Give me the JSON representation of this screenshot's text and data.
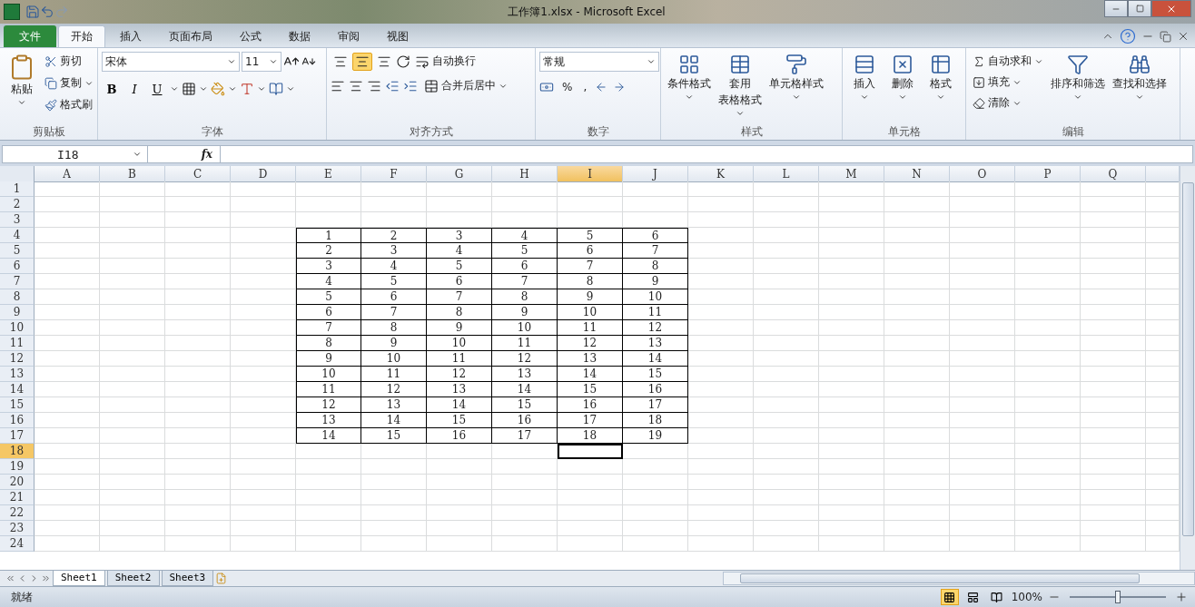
{
  "window": {
    "title": "工作簿1.xlsx  -  Microsoft Excel"
  },
  "ribbon_tabs": [
    {
      "label": "文件",
      "kind": "file",
      "selected": false
    },
    {
      "label": "开始",
      "kind": "tab",
      "selected": true
    },
    {
      "label": "插入",
      "kind": "tab",
      "selected": false
    },
    {
      "label": "页面布局",
      "kind": "tab",
      "selected": false
    },
    {
      "label": "公式",
      "kind": "tab",
      "selected": false
    },
    {
      "label": "数据",
      "kind": "tab",
      "selected": false
    },
    {
      "label": "审阅",
      "kind": "tab",
      "selected": false
    },
    {
      "label": "视图",
      "kind": "tab",
      "selected": false
    }
  ],
  "groups": [
    {
      "kind": "clipboard",
      "label": "剪贴板",
      "paste": "粘贴",
      "items": [
        "剪切",
        "复制",
        "格式刷"
      ]
    },
    {
      "kind": "font",
      "label": "字体",
      "font": "宋体",
      "size": "11",
      "bold": "B",
      "italic": "I",
      "underline": "U"
    },
    {
      "kind": "alignment",
      "label": "对齐方式",
      "vertical": [
        {
          "selected": false
        },
        {
          "selected": true
        },
        {
          "selected": false
        }
      ],
      "wrap": "自动换行",
      "merge": "合并后居中"
    },
    {
      "kind": "number",
      "label": "数字",
      "format": "常规",
      "percent": "%",
      "comma": ","
    },
    {
      "kind": "styles",
      "label": "样式",
      "buttons": [
        {
          "lines": [
            "条件格式"
          ]
        },
        {
          "lines": [
            "套用",
            "表格格式"
          ]
        },
        {
          "lines": [
            "单元格样式"
          ]
        }
      ]
    },
    {
      "kind": "cells",
      "label": "单元格",
      "buttons": [
        "插入",
        "删除",
        "格式"
      ]
    },
    {
      "kind": "editing",
      "label": "编辑",
      "small": [
        "自动求和",
        "填充",
        "清除"
      ],
      "large": [
        "排序和筛选",
        "查找和选择"
      ]
    }
  ],
  "formula_bar": {
    "name_box": "I18",
    "fx": "fx"
  },
  "sheet": {
    "columns": [
      {
        "label": "A",
        "selected": false
      },
      {
        "label": "B",
        "selected": false
      },
      {
        "label": "C",
        "selected": false
      },
      {
        "label": "D",
        "selected": false
      },
      {
        "label": "E",
        "selected": false
      },
      {
        "label": "F",
        "selected": false
      },
      {
        "label": "G",
        "selected": false
      },
      {
        "label": "H",
        "selected": false
      },
      {
        "label": "I",
        "selected": true
      },
      {
        "label": "J",
        "selected": false
      },
      {
        "label": "K",
        "selected": false
      },
      {
        "label": "L",
        "selected": false
      },
      {
        "label": "M",
        "selected": false
      },
      {
        "label": "N",
        "selected": false
      },
      {
        "label": "O",
        "selected": false
      },
      {
        "label": "P",
        "selected": false
      },
      {
        "label": "Q",
        "selected": false
      }
    ],
    "rows": [
      {
        "number": "1",
        "selected": false
      },
      {
        "number": "2",
        "selected": false
      },
      {
        "number": "3",
        "selected": false
      },
      {
        "number": "4",
        "selected": false,
        "values": [
          "1",
          "2",
          "3",
          "4",
          "5",
          "6"
        ]
      },
      {
        "number": "5",
        "selected": false,
        "values": [
          "2",
          "3",
          "4",
          "5",
          "6",
          "7"
        ]
      },
      {
        "number": "6",
        "selected": false,
        "values": [
          "3",
          "4",
          "5",
          "6",
          "7",
          "8"
        ]
      },
      {
        "number": "7",
        "selected": false,
        "values": [
          "4",
          "5",
          "6",
          "7",
          "8",
          "9"
        ]
      },
      {
        "number": "8",
        "selected": false,
        "values": [
          "5",
          "6",
          "7",
          "8",
          "9",
          "10"
        ]
      },
      {
        "number": "9",
        "selected": false,
        "values": [
          "6",
          "7",
          "8",
          "9",
          "10",
          "11"
        ]
      },
      {
        "number": "10",
        "selected": false,
        "values": [
          "7",
          "8",
          "9",
          "10",
          "11",
          "12"
        ]
      },
      {
        "number": "11",
        "selected": false,
        "values": [
          "8",
          "9",
          "10",
          "11",
          "12",
          "13"
        ]
      },
      {
        "number": "12",
        "selected": false,
        "values": [
          "9",
          "10",
          "11",
          "12",
          "13",
          "14"
        ]
      },
      {
        "number": "13",
        "selected": false,
        "values": [
          "10",
          "11",
          "12",
          "13",
          "14",
          "15"
        ]
      },
      {
        "number": "14",
        "selected": false,
        "values": [
          "11",
          "12",
          "13",
          "14",
          "15",
          "16"
        ]
      },
      {
        "number": "15",
        "selected": false,
        "values": [
          "12",
          "13",
          "14",
          "15",
          "16",
          "17"
        ]
      },
      {
        "number": "16",
        "selected": false,
        "values": [
          "13",
          "14",
          "15",
          "16",
          "17",
          "18"
        ]
      },
      {
        "number": "17",
        "selected": false,
        "values": [
          "14",
          "15",
          "16",
          "17",
          "18",
          "19"
        ]
      },
      {
        "number": "18",
        "selected": true
      },
      {
        "number": "19",
        "selected": false
      },
      {
        "number": "20",
        "selected": false
      },
      {
        "number": "21",
        "selected": false
      },
      {
        "number": "22",
        "selected": false
      },
      {
        "number": "23",
        "selected": false
      },
      {
        "number": "24",
        "selected": false
      }
    ]
  },
  "sheet_tabs": [
    {
      "label": "Sheet1",
      "selected": true
    },
    {
      "label": "Sheet2",
      "selected": false
    },
    {
      "label": "Sheet3",
      "selected": false
    }
  ],
  "status_bar": {
    "text": "就绪",
    "views": [
      {
        "selected": true
      },
      {
        "selected": false
      },
      {
        "selected": false
      }
    ],
    "zoom": "100%",
    "zoom_slider": {
      "level": 0.5
    }
  }
}
